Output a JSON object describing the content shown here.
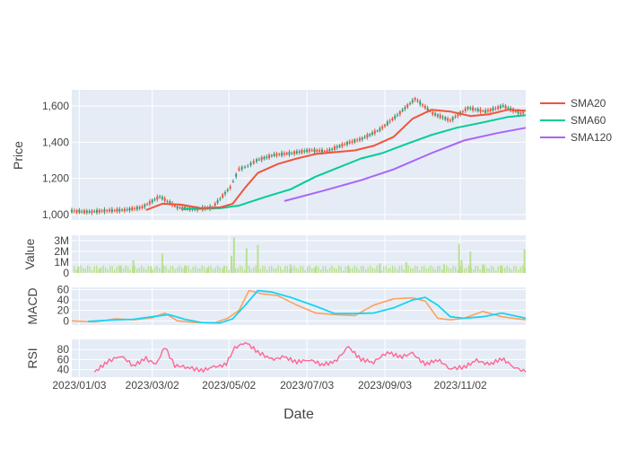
{
  "chart_data": {
    "type": "line",
    "xlabel": "Date",
    "x_tick_labels": [
      "2023/01/03",
      "2023/03/02",
      "2023/05/02",
      "2023/07/03",
      "2023/09/03",
      "2023/11/02"
    ],
    "x_range": [
      "2022-12-28",
      "2023-12-24"
    ],
    "colors": {
      "plot_bg": "#e5ecf6",
      "grid": "#ffffff",
      "candle_up": "#3d9970",
      "candle_down": "#ef553b",
      "sma20": "#ef553b",
      "sma60": "#00cc96",
      "sma120": "#ab63fa",
      "volume": "#b9e08e",
      "macd": "#ffa15a",
      "signal": "#19d3f3",
      "rsi": "#ff6692"
    },
    "legend": {
      "position": "top-right",
      "entries": [
        {
          "key": "sma20",
          "label": "SMA20"
        },
        {
          "key": "sma60",
          "label": "SMA60"
        },
        {
          "key": "sma120",
          "label": "SMA120"
        }
      ]
    },
    "price_panel": {
      "ylabel": "Price",
      "ylim": [
        970,
        1690
      ],
      "yticks": [
        {
          "v": 1000,
          "label": "1,000"
        },
        {
          "v": 1200,
          "label": "1,200"
        },
        {
          "v": 1400,
          "label": "1,400"
        },
        {
          "v": 1600,
          "label": "1,600"
        }
      ],
      "candles": {
        "type": "candlestick",
        "dates": [
          "2022-12-28",
          "2023-01-11",
          "2023-01-25",
          "2023-02-08",
          "2023-02-22",
          "2023-03-08",
          "2023-03-22",
          "2023-04-05",
          "2023-04-19",
          "2023-05-03",
          "2023-05-10",
          "2023-05-17",
          "2023-05-24",
          "2023-06-07",
          "2023-06-21",
          "2023-07-05",
          "2023-07-19",
          "2023-08-02",
          "2023-08-16",
          "2023-08-30",
          "2023-09-13",
          "2023-09-27",
          "2023-10-11",
          "2023-10-25",
          "2023-11-08",
          "2023-11-22",
          "2023-12-06",
          "2023-12-20",
          "2023-12-24"
        ],
        "close": [
          1020,
          1015,
          1022,
          1025,
          1040,
          1100,
          1040,
          1030,
          1040,
          1150,
          1250,
          1270,
          1300,
          1330,
          1340,
          1355,
          1350,
          1390,
          1420,
          1470,
          1550,
          1640,
          1560,
          1520,
          1590,
          1570,
          1600,
          1560,
          1570
        ]
      },
      "sma20": {
        "dates": [
          "2023-02-25",
          "2023-03-10",
          "2023-03-25",
          "2023-04-10",
          "2023-04-25",
          "2023-05-05",
          "2023-05-15",
          "2023-05-25",
          "2023-06-10",
          "2023-06-25",
          "2023-07-10",
          "2023-07-25",
          "2023-08-10",
          "2023-08-25",
          "2023-09-10",
          "2023-09-25",
          "2023-10-10",
          "2023-10-25",
          "2023-11-10",
          "2023-11-25",
          "2023-12-10",
          "2023-12-24"
        ],
        "values": [
          1025,
          1060,
          1055,
          1035,
          1040,
          1060,
          1150,
          1230,
          1280,
          1310,
          1335,
          1345,
          1355,
          1380,
          1430,
          1530,
          1580,
          1570,
          1545,
          1555,
          1580,
          1575
        ]
      },
      "sma60": {
        "dates": [
          "2023-03-25",
          "2023-04-25",
          "2023-05-10",
          "2023-06-01",
          "2023-06-20",
          "2023-07-10",
          "2023-07-28",
          "2023-08-15",
          "2023-09-01",
          "2023-09-20",
          "2023-10-10",
          "2023-10-30",
          "2023-11-20",
          "2023-12-10",
          "2023-12-24"
        ],
        "values": [
          1030,
          1035,
          1050,
          1100,
          1140,
          1210,
          1260,
          1310,
          1340,
          1390,
          1440,
          1480,
          1510,
          1540,
          1550
        ]
      },
      "sma120": {
        "dates": [
          "2023-06-15",
          "2023-07-15",
          "2023-08-15",
          "2023-09-10",
          "2023-10-10",
          "2023-11-05",
          "2023-12-01",
          "2023-12-24"
        ],
        "values": [
          1075,
          1130,
          1190,
          1250,
          1340,
          1410,
          1450,
          1480
        ]
      }
    },
    "volume_panel": {
      "ylabel": "Value",
      "type": "bar",
      "ylim": [
        0,
        3500000
      ],
      "yticks": [
        {
          "v": 0,
          "label": "0"
        },
        {
          "v": 1000000,
          "label": "1M"
        },
        {
          "v": 2000000,
          "label": "2M"
        },
        {
          "v": 3000000,
          "label": "3M"
        }
      ],
      "dates": [
        "2023-01-02",
        "2023-01-20",
        "2023-02-05",
        "2023-02-15",
        "2023-03-01",
        "2023-03-10",
        "2023-03-28",
        "2023-04-15",
        "2023-04-28",
        "2023-05-04",
        "2023-05-06",
        "2023-05-16",
        "2023-05-25",
        "2023-06-20",
        "2023-07-10",
        "2023-08-05",
        "2023-08-30",
        "2023-09-20",
        "2023-10-20",
        "2023-11-01",
        "2023-11-03",
        "2023-11-10",
        "2023-11-20",
        "2023-12-05",
        "2023-12-23"
      ],
      "values": [
        600000,
        500000,
        700000,
        1200000,
        600000,
        1800000,
        700000,
        500000,
        600000,
        1600000,
        3300000,
        2300000,
        2600000,
        800000,
        600000,
        700000,
        900000,
        1000000,
        800000,
        2700000,
        1200000,
        2000000,
        800000,
        700000,
        2200000
      ]
    },
    "macd_panel": {
      "ylabel": "MACD",
      "ylim": [
        -8,
        64
      ],
      "yticks": [
        {
          "v": 0,
          "label": "0"
        },
        {
          "v": 20,
          "label": "20"
        },
        {
          "v": 40,
          "label": "40"
        },
        {
          "v": 60,
          "label": "60"
        }
      ],
      "macd": {
        "dates": [
          "2022-12-28",
          "2023-01-15",
          "2023-02-01",
          "2023-02-15",
          "2023-03-02",
          "2023-03-12",
          "2023-03-22",
          "2023-04-05",
          "2023-04-20",
          "2023-05-01",
          "2023-05-10",
          "2023-05-18",
          "2023-05-28",
          "2023-06-10",
          "2023-06-25",
          "2023-07-10",
          "2023-07-25",
          "2023-08-10",
          "2023-08-25",
          "2023-09-10",
          "2023-09-25",
          "2023-10-05",
          "2023-10-15",
          "2023-10-25",
          "2023-11-05",
          "2023-11-20",
          "2023-12-05",
          "2023-12-24"
        ],
        "values": [
          0,
          -2,
          4,
          2,
          6,
          15,
          0,
          -3,
          -4,
          5,
          20,
          58,
          52,
          48,
          30,
          15,
          12,
          10,
          30,
          42,
          44,
          38,
          5,
          2,
          5,
          18,
          8,
          2
        ]
      },
      "signal": {
        "dates": [
          "2023-01-10",
          "2023-02-01",
          "2023-02-15",
          "2023-03-02",
          "2023-03-15",
          "2023-03-28",
          "2023-04-10",
          "2023-04-25",
          "2023-05-05",
          "2023-05-15",
          "2023-05-25",
          "2023-06-05",
          "2023-06-20",
          "2023-07-10",
          "2023-07-25",
          "2023-08-10",
          "2023-08-25",
          "2023-09-10",
          "2023-09-25",
          "2023-10-05",
          "2023-10-15",
          "2023-10-25",
          "2023-11-05",
          "2023-11-20",
          "2023-12-05",
          "2023-12-24"
        ],
        "values": [
          -1,
          2,
          3,
          8,
          12,
          3,
          -3,
          -4,
          4,
          30,
          58,
          55,
          45,
          28,
          14,
          14,
          15,
          25,
          40,
          45,
          30,
          8,
          5,
          8,
          15,
          5
        ]
      }
    },
    "rsi_panel": {
      "ylabel": "RSI",
      "ylim": [
        25,
        100
      ],
      "yticks": [
        {
          "v": 40,
          "label": "40"
        },
        {
          "v": 60,
          "label": "60"
        },
        {
          "v": 80,
          "label": "80"
        }
      ],
      "rsi": {
        "dates": [
          "2023-01-15",
          "2023-01-25",
          "2023-02-05",
          "2023-02-15",
          "2023-02-25",
          "2023-03-05",
          "2023-03-12",
          "2023-03-20",
          "2023-03-30",
          "2023-04-10",
          "2023-04-20",
          "2023-04-30",
          "2023-05-05",
          "2023-05-15",
          "2023-05-25",
          "2023-06-05",
          "2023-06-15",
          "2023-06-25",
          "2023-07-05",
          "2023-07-15",
          "2023-07-25",
          "2023-08-05",
          "2023-08-15",
          "2023-08-25",
          "2023-09-05",
          "2023-09-15",
          "2023-09-25",
          "2023-10-05",
          "2023-10-15",
          "2023-10-25",
          "2023-11-05",
          "2023-11-15",
          "2023-11-25",
          "2023-12-05",
          "2023-12-15",
          "2023-12-24"
        ],
        "values": [
          35,
          55,
          68,
          48,
          62,
          50,
          85,
          48,
          45,
          38,
          45,
          50,
          80,
          95,
          75,
          60,
          65,
          55,
          60,
          50,
          55,
          85,
          60,
          55,
          75,
          65,
          72,
          50,
          60,
          42,
          45,
          58,
          50,
          62,
          45,
          35
        ]
      }
    }
  }
}
